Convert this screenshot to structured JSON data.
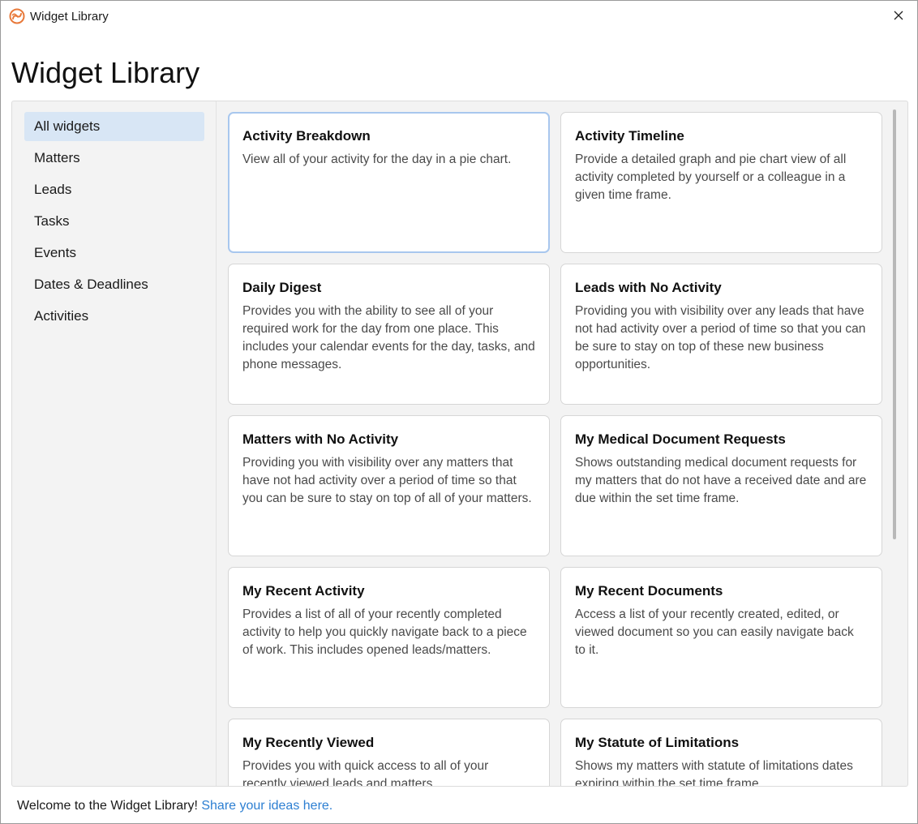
{
  "window": {
    "title": "Widget Library",
    "accent_color": "#e8793a"
  },
  "page": {
    "heading": "Widget Library"
  },
  "sidebar": {
    "items": [
      {
        "label": "All widgets",
        "active": true
      },
      {
        "label": "Matters"
      },
      {
        "label": "Leads"
      },
      {
        "label": "Tasks"
      },
      {
        "label": "Events"
      },
      {
        "label": "Dates & Deadlines"
      },
      {
        "label": "Activities"
      }
    ]
  },
  "widgets": [
    {
      "title": "Activity Breakdown",
      "description": "View all of your activity for the day in a pie chart."
    },
    {
      "title": "Activity Timeline",
      "description": "Provide a detailed graph and pie chart view of all activity completed by yourself or a colleague in a given time frame."
    },
    {
      "title": "Daily Digest",
      "description": "Provides you with the ability to see all of your required work for the day from one place. This includes your calendar events for the day, tasks, and phone messages."
    },
    {
      "title": "Leads with No Activity",
      "description": "Providing you with visibility over any leads that have not had activity over a period of time so that you can be sure to stay on top of these new business opportunities."
    },
    {
      "title": "Matters with No Activity",
      "description": "Providing you with visibility over any matters that have not had activity over a period of time so that you can be sure to stay on top of all of your matters."
    },
    {
      "title": "My Medical Document Requests",
      "description": "Shows outstanding medical document requests for my matters that do not have a received date and are due within the set time frame."
    },
    {
      "title": "My Recent Activity",
      "description": "Provides a list of all of your recently completed activity to help you quickly navigate back to a piece of work. This includes opened leads/matters."
    },
    {
      "title": "My Recent Documents",
      "description": "Access a list of your recently created, edited, or viewed document so you can easily navigate back to it."
    },
    {
      "title": "My Recently Viewed",
      "description": "Provides you with quick access to all of your recently viewed leads and matters."
    },
    {
      "title": "My Statute of Limitations",
      "description": "Shows my matters with statute of limitations dates expiring within the set time frame."
    }
  ],
  "footer": {
    "text": "Welcome to the Widget Library! ",
    "link": "Share your ideas here."
  }
}
